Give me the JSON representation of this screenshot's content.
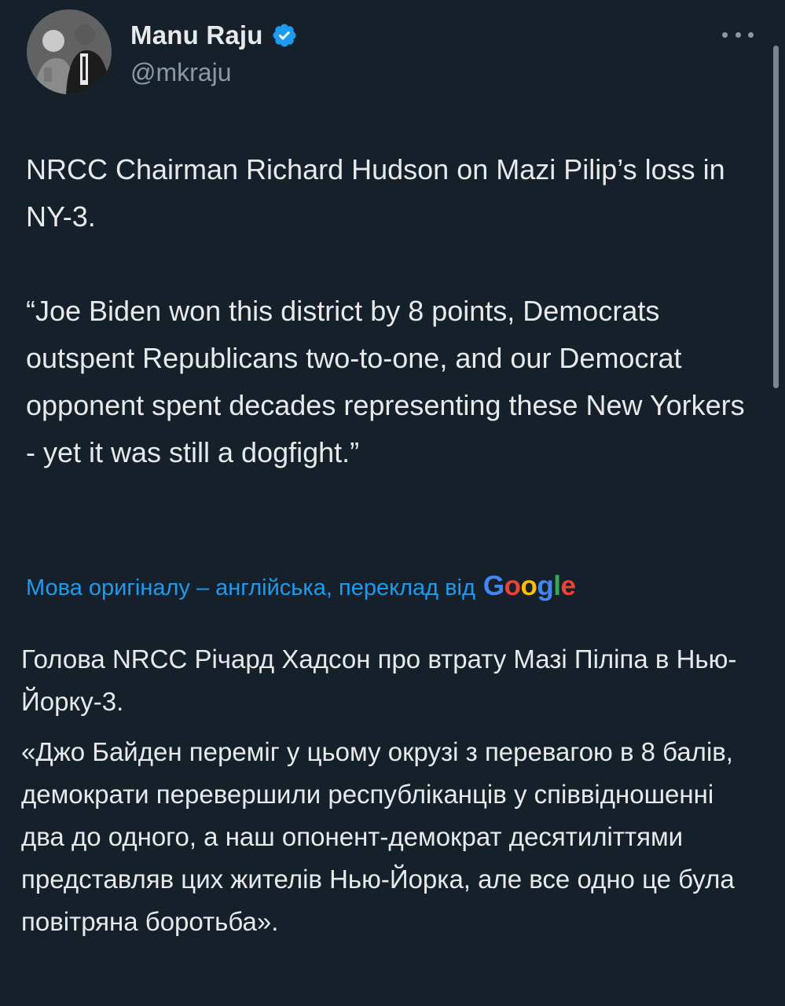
{
  "author": {
    "display_name": "Manu Raju",
    "handle": "@mkraju",
    "avatar_alt": "profile-photo"
  },
  "tweet": {
    "text": "NRCC Chairman Richard Hudson on Mazi Pilip’s loss in NY-3.\n\n“Joe Biden won this district by 8 points, Democrats outspent Republicans two-to-one, and our Democrat opponent spent decades representing these New Yorkers - yet it was still a dogfight.”"
  },
  "translation": {
    "label": "Мова оригіналу – англійська, переклад від",
    "provider": "Google",
    "paragraph_1": "Голова NRCC Річард Хадсон про втрату Мазі Пiліпа в Нью-Йорку-3.",
    "paragraph_2": "«Джо Байден переміг у цьому окрузі з перевагою в 8 балів, демократи перевершили республіканців у співвідношенні два до одного, а наш опонент-демократ десятиліттями представляв цих жителів Нью-Йорка, але все одно це була повітряна боротьба»."
  },
  "colors": {
    "background": "#15202b",
    "text": "#e7e9ea",
    "secondary": "#8b98a5",
    "accent": "#1d9bf0",
    "google_blue": "#4285f4",
    "google_red": "#ea4335",
    "google_yellow": "#fbbc05",
    "google_green": "#34a853"
  },
  "icons": {
    "verified": "verified-badge-icon",
    "more": "more-options-icon"
  }
}
